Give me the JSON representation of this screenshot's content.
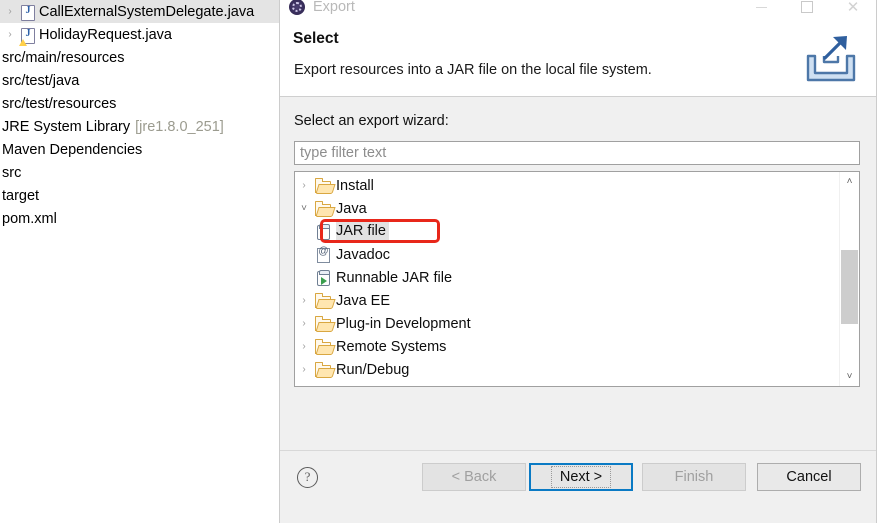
{
  "explorer": {
    "items": [
      {
        "label": "CallExternalSystemDelegate.java",
        "icon": "java-file-icon",
        "arrow": "›",
        "selected": true,
        "indent": 0,
        "sub": ""
      },
      {
        "label": "HolidayRequest.java",
        "icon": "java-file-warn-icon",
        "arrow": "›",
        "selected": false,
        "indent": 0,
        "sub": ""
      },
      {
        "label": "src/main/resources",
        "icon": "none",
        "arrow": "",
        "selected": false,
        "indent": 0,
        "sub": ""
      },
      {
        "label": "src/test/java",
        "icon": "none",
        "arrow": "",
        "selected": false,
        "indent": 0,
        "sub": ""
      },
      {
        "label": "src/test/resources",
        "icon": "none",
        "arrow": "",
        "selected": false,
        "indent": 0,
        "sub": ""
      },
      {
        "label": "JRE System Library",
        "icon": "none",
        "arrow": "",
        "selected": false,
        "indent": 0,
        "sub": "[jre1.8.0_251]"
      },
      {
        "label": "Maven Dependencies",
        "icon": "none",
        "arrow": "",
        "selected": false,
        "indent": 0,
        "sub": ""
      },
      {
        "label": "src",
        "icon": "none",
        "arrow": "",
        "selected": false,
        "indent": 0,
        "sub": ""
      },
      {
        "label": "target",
        "icon": "none",
        "arrow": "",
        "selected": false,
        "indent": 0,
        "sub": ""
      },
      {
        "label": "pom.xml",
        "icon": "none",
        "arrow": "",
        "selected": false,
        "indent": 0,
        "sub": ""
      }
    ]
  },
  "dialog": {
    "titlebar": {
      "title": "Export",
      "app_icon": "eclipse-icon",
      "minimize_label": "–",
      "maximize_label": "□",
      "close_label": "✕"
    },
    "header": {
      "title": "Select",
      "description": "Export resources into a JAR file on the local file system.",
      "banner_icon": "export-arrow-icon"
    },
    "body": {
      "label": "Select an export wizard:",
      "filter": {
        "value": "",
        "placeholder": "type filter text"
      },
      "tree": [
        {
          "label": "Install",
          "icon": "folder-icon",
          "arrow": "›",
          "expanded": false,
          "level": 0,
          "selected": false
        },
        {
          "label": "Java",
          "icon": "folder-icon",
          "arrow": "˅",
          "expanded": true,
          "level": 0,
          "selected": false
        },
        {
          "label": "JAR file",
          "icon": "jar-icon",
          "arrow": "",
          "expanded": false,
          "level": 1,
          "selected": true
        },
        {
          "label": "Javadoc",
          "icon": "javadoc-icon",
          "arrow": "",
          "expanded": false,
          "level": 1,
          "selected": false
        },
        {
          "label": "Runnable JAR file",
          "icon": "runnable-jar-icon",
          "arrow": "",
          "expanded": false,
          "level": 1,
          "selected": false
        },
        {
          "label": "Java EE",
          "icon": "folder-icon",
          "arrow": "›",
          "expanded": false,
          "level": 0,
          "selected": false
        },
        {
          "label": "Plug-in Development",
          "icon": "folder-icon",
          "arrow": "›",
          "expanded": false,
          "level": 0,
          "selected": false
        },
        {
          "label": "Remote Systems",
          "icon": "folder-icon",
          "arrow": "›",
          "expanded": false,
          "level": 0,
          "selected": false
        },
        {
          "label": "Run/Debug",
          "icon": "folder-icon",
          "arrow": "›",
          "expanded": false,
          "level": 0,
          "selected": false
        }
      ],
      "scrollbar": {
        "up_arrow": "˄",
        "down_arrow": "˅"
      },
      "annotation": {
        "target": "JAR file",
        "color": "#e8271a"
      }
    },
    "footer": {
      "help_label": "?",
      "back_label": "< Back",
      "next_label": "Next >",
      "finish_label": "Finish",
      "cancel_label": "Cancel"
    }
  }
}
